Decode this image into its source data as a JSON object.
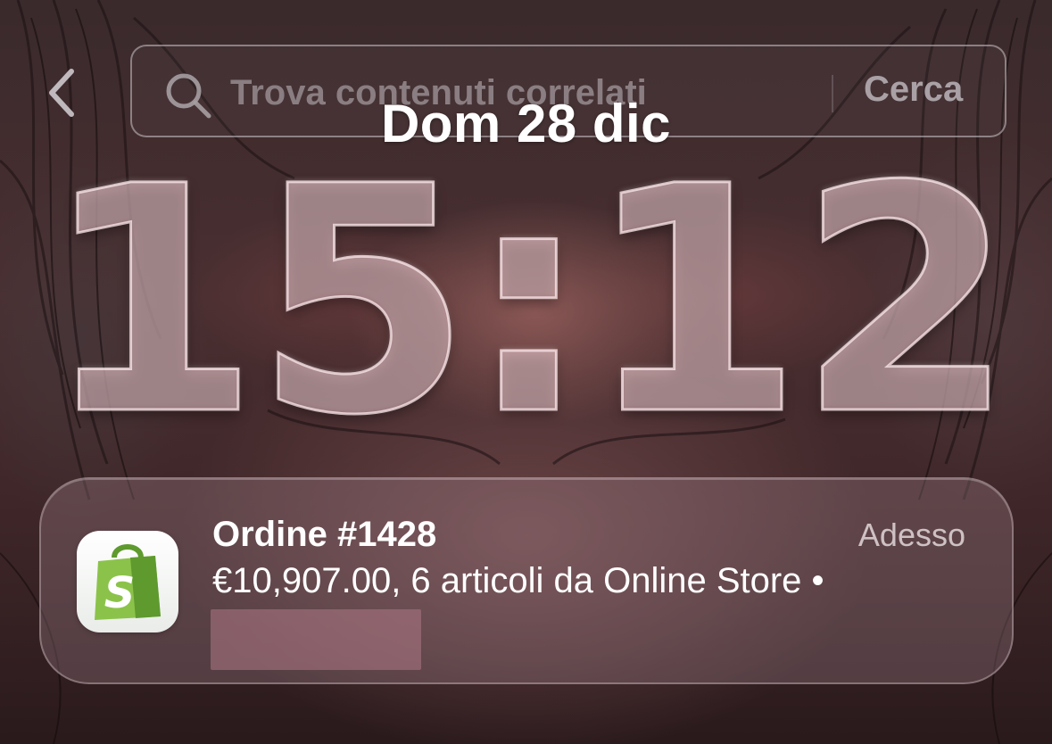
{
  "search": {
    "placeholder": "Trova contenuti correlati",
    "button_label": "Cerca",
    "icon": "search-icon"
  },
  "navigation": {
    "back_icon": "chevron-left-icon"
  },
  "lockscreen": {
    "date": "Dom 28 dic",
    "time": "15:12"
  },
  "notification": {
    "app_icon": "shopify-bag-icon",
    "title": "Ordine #1428",
    "time": "Adesso",
    "body": "€10,907.00, 6 articoli da Online Store •"
  },
  "colors": {
    "notification_bg": "#aa8c94",
    "app_icon_green": "#7cb342",
    "clock_fill": "#e1b9c0"
  }
}
